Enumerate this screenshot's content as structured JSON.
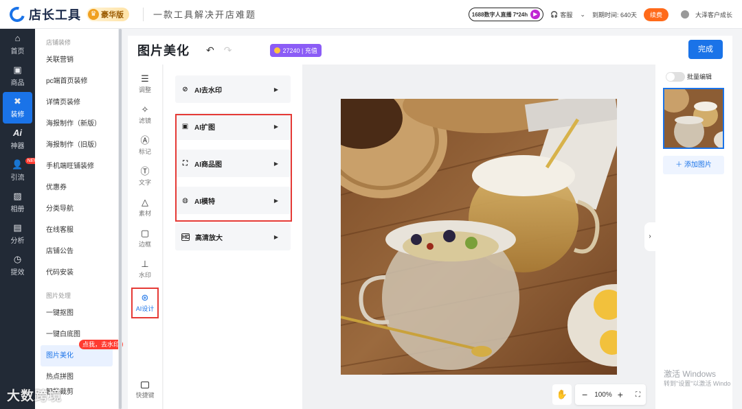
{
  "header": {
    "app_title": "店长工具",
    "vip_label": "豪华版",
    "slogan": "一款工具解决开店难题",
    "live_text": "1688数字人直播 7*24h",
    "service": "客服",
    "expiry": "到期时间: 640天",
    "renew": "续费",
    "user": "大泽客户成长"
  },
  "leftnav": {
    "items": [
      {
        "label": "首页",
        "icon": "home-icon"
      },
      {
        "label": "商品",
        "icon": "box-icon"
      },
      {
        "label": "装修",
        "icon": "brush-icon",
        "active": true
      },
      {
        "label": "神器",
        "icon": "ai-icon"
      },
      {
        "label": "引流",
        "icon": "user-icon",
        "badge": "NEW"
      },
      {
        "label": "相册",
        "icon": "image-icon"
      },
      {
        "label": "分析",
        "icon": "chart-icon"
      },
      {
        "label": "提效",
        "icon": "clock-icon"
      }
    ]
  },
  "submenu": {
    "group1_title": "店铺装修",
    "group1": [
      "关联营销",
      "pc端首页装修",
      "详情页装修",
      "海报制作（新版）",
      "海报制作（旧版）",
      "手机端旺铺装修",
      "优惠券",
      "分类导航",
      "在线客服",
      "店铺公告",
      "代码安装"
    ],
    "group2_title": "图片处理",
    "group2": [
      "一键抠图",
      "一键白底图",
      "图片美化",
      "热点拼图",
      "智能裁剪"
    ],
    "tip_badge": "点我，去水印"
  },
  "editor": {
    "title": "图片美化",
    "points": "27240 | 充值",
    "done": "完成",
    "tools": [
      {
        "label": "调整",
        "icon": "sliders-icon"
      },
      {
        "label": "滤镜",
        "icon": "sparkle-icon"
      },
      {
        "label": "标记",
        "icon": "pen-icon"
      },
      {
        "label": "文字",
        "icon": "text-icon"
      },
      {
        "label": "素材",
        "icon": "shapes-icon"
      },
      {
        "label": "边框",
        "icon": "frame-icon"
      },
      {
        "label": "水印",
        "icon": "stamp-icon"
      },
      {
        "label": "AI设计",
        "icon": "ai-design-icon",
        "active": true
      }
    ],
    "shortcut": "快捷键",
    "panel_items": [
      {
        "label": "AI去水印",
        "icon": "remove-watermark-icon"
      },
      {
        "label": "AI扩图",
        "icon": "expand-icon"
      },
      {
        "label": "AI商品图",
        "icon": "product-icon"
      },
      {
        "label": "AI模特",
        "icon": "model-icon"
      },
      {
        "label": "高清放大",
        "icon": "hd-icon"
      }
    ],
    "zoom": "100%",
    "batch_edit": "批量编辑",
    "add_image": "添加图片"
  },
  "os": {
    "activate_title": "激活 Windows",
    "activate_sub": "转到\"设置\"以激活 Windo"
  },
  "watermark": "大数跨境"
}
